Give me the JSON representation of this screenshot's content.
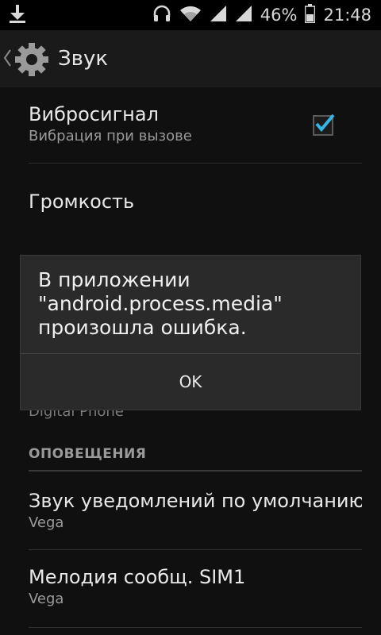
{
  "status_bar": {
    "battery_percent": "46%",
    "time": "21:48",
    "icons": [
      "download-icon",
      "headphones-icon",
      "wifi-icon",
      "signal-icon",
      "signal-icon",
      "battery-icon"
    ]
  },
  "action_bar": {
    "title": "Звук",
    "icon": "settings-icon"
  },
  "list": {
    "items": [
      {
        "title": "Вибросигнал",
        "subtitle": "Вибрация при вызове",
        "checked": true
      },
      {
        "title": "Громкость"
      },
      {
        "subtitle": "Digital Phone"
      },
      {
        "title": "Звук уведомлений по умолчанию",
        "subtitle": "Vega"
      },
      {
        "title": "Мелодия сообщ. SIM1",
        "subtitle": "Vega"
      }
    ],
    "section_header": "ОПОВЕЩЕНИЯ"
  },
  "dialog": {
    "message": "В приложении \"android.process.media\" произошла ошибка.",
    "ok_label": "OK"
  }
}
